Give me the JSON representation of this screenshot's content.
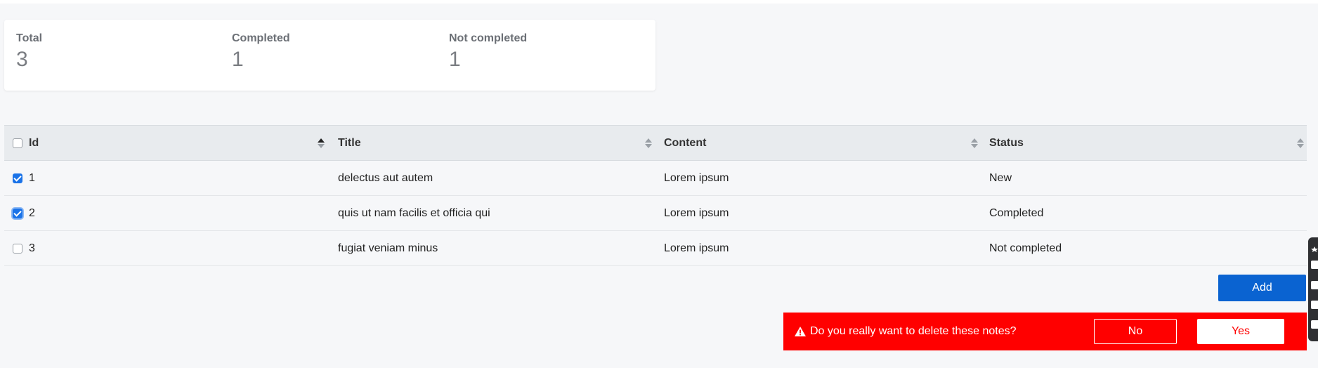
{
  "stats": {
    "total_label": "Total",
    "total_value": "3",
    "completed_label": "Completed",
    "completed_value": "1",
    "not_completed_label": "Not completed",
    "not_completed_value": "1"
  },
  "table": {
    "columns": [
      "Id",
      "Title",
      "Content",
      "Status"
    ],
    "rows": [
      {
        "id": "1",
        "title": "delectus aut autem",
        "content": "Lorem ipsum",
        "status": "New",
        "checked": true
      },
      {
        "id": "2",
        "title": "quis ut nam facilis et officia qui",
        "content": "Lorem ipsum",
        "status": "Completed",
        "checked": true
      },
      {
        "id": "3",
        "title": "fugiat veniam minus",
        "content": "Lorem ipsum",
        "status": "Not completed",
        "checked": false
      }
    ]
  },
  "actions": {
    "add_label": "Add"
  },
  "confirm": {
    "message": "Do you really want to delete these notes?",
    "no_label": "No",
    "yes_label": "Yes"
  },
  "colors": {
    "primary": "#0a63d1",
    "danger": "#ff0000",
    "checkbox_checked": "#1a73e8"
  },
  "icons": {
    "sort": "sort-icon",
    "warning": "warning-icon",
    "toolbar": [
      "star-icon",
      "camera-icon",
      "square-icon",
      "copy-icon",
      "gear-icon"
    ]
  }
}
